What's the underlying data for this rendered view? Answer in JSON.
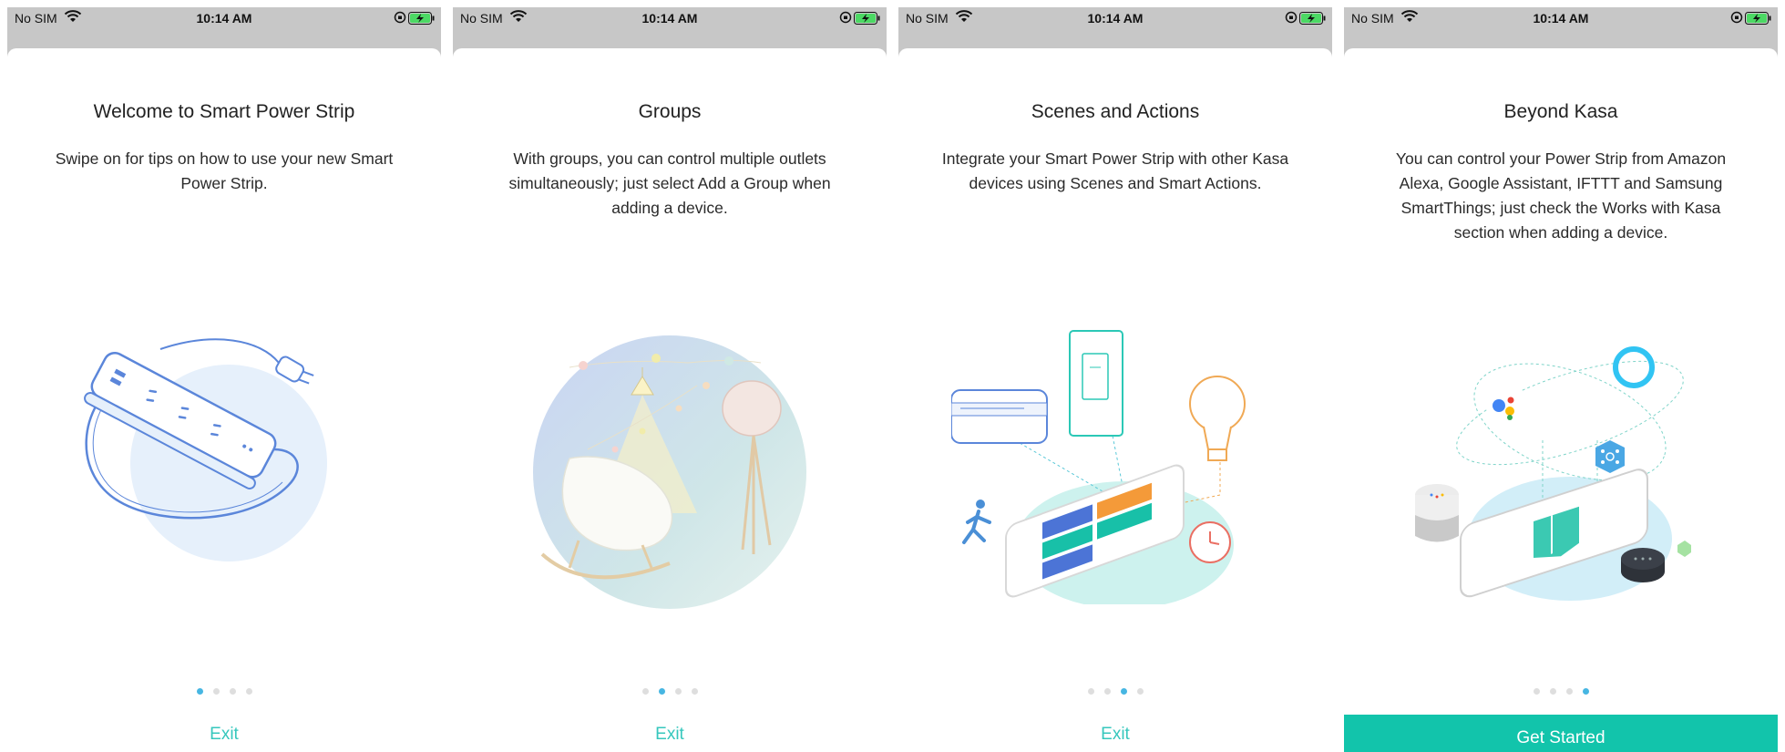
{
  "status_bar": {
    "carrier": "No SIM",
    "time": "10:14 AM",
    "icons": [
      "wifi-icon",
      "orientation-lock-icon",
      "battery-charging-icon"
    ]
  },
  "colors": {
    "accent": "#36c7bd",
    "button": "#12c4ab",
    "dot_active": "#47b6e2",
    "dot_inactive": "#dedede"
  },
  "screens": [
    {
      "title": "Welcome to Smart Power Strip",
      "description": "Swipe on for tips on how to use your new Smart Power Strip.",
      "illustration": "power-strip-illustration",
      "active_page": 1,
      "action": "Exit"
    },
    {
      "title": "Groups",
      "description": "With groups, you can control multiple outlets simultaneously; just select Add a Group when adding a device.",
      "illustration": "groups-lamps-chair-illustration",
      "active_page": 2,
      "action": "Exit"
    },
    {
      "title": "Scenes and Actions",
      "description": "Integrate your Smart Power Strip with other Kasa devices using Scenes and Smart Actions.",
      "illustration": "scenes-smart-home-illustration",
      "active_page": 3,
      "action": "Exit"
    },
    {
      "title": "Beyond Kasa",
      "description": "You can control your Power Strip from Amazon Alexa, Google Assistant, IFTTT and Samsung SmartThings; just check the Works with Kasa section when adding a device.",
      "illustration": "voice-assistants-illustration",
      "active_page": 4,
      "action": "Get Started"
    }
  ],
  "page_count": 4
}
